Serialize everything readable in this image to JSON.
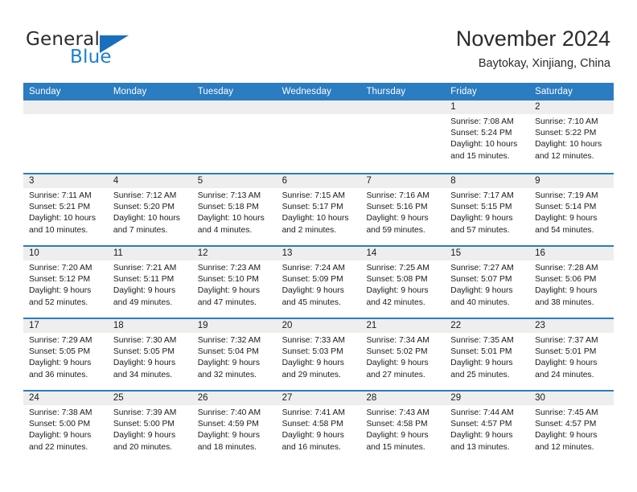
{
  "brand": {
    "name_part1": "General",
    "name_part2": "Blue",
    "logo_icon": "blue-triangle-icon"
  },
  "header": {
    "month_title": "November 2024",
    "location": "Baytokay, Xinjiang, China"
  },
  "colors": {
    "header_blue": "#2b7cc0",
    "day_band_gray": "#eeeeee",
    "brand_blue": "#1a7fd4",
    "text": "#1a1a1a"
  },
  "weekdays": [
    "Sunday",
    "Monday",
    "Tuesday",
    "Wednesday",
    "Thursday",
    "Friday",
    "Saturday"
  ],
  "labels": {
    "sunrise_prefix": "Sunrise: ",
    "sunset_prefix": "Sunset: ",
    "daylight_prefix": "Daylight: "
  },
  "weeks": [
    [
      {
        "day": "",
        "empty": true
      },
      {
        "day": "",
        "empty": true
      },
      {
        "day": "",
        "empty": true
      },
      {
        "day": "",
        "empty": true
      },
      {
        "day": "",
        "empty": true
      },
      {
        "day": "1",
        "sunrise": "Sunrise: 7:08 AM",
        "sunset": "Sunset: 5:24 PM",
        "daylight": "Daylight: 10 hours and 15 minutes."
      },
      {
        "day": "2",
        "sunrise": "Sunrise: 7:10 AM",
        "sunset": "Sunset: 5:22 PM",
        "daylight": "Daylight: 10 hours and 12 minutes."
      }
    ],
    [
      {
        "day": "3",
        "sunrise": "Sunrise: 7:11 AM",
        "sunset": "Sunset: 5:21 PM",
        "daylight": "Daylight: 10 hours and 10 minutes."
      },
      {
        "day": "4",
        "sunrise": "Sunrise: 7:12 AM",
        "sunset": "Sunset: 5:20 PM",
        "daylight": "Daylight: 10 hours and 7 minutes."
      },
      {
        "day": "5",
        "sunrise": "Sunrise: 7:13 AM",
        "sunset": "Sunset: 5:18 PM",
        "daylight": "Daylight: 10 hours and 4 minutes."
      },
      {
        "day": "6",
        "sunrise": "Sunrise: 7:15 AM",
        "sunset": "Sunset: 5:17 PM",
        "daylight": "Daylight: 10 hours and 2 minutes."
      },
      {
        "day": "7",
        "sunrise": "Sunrise: 7:16 AM",
        "sunset": "Sunset: 5:16 PM",
        "daylight": "Daylight: 9 hours and 59 minutes."
      },
      {
        "day": "8",
        "sunrise": "Sunrise: 7:17 AM",
        "sunset": "Sunset: 5:15 PM",
        "daylight": "Daylight: 9 hours and 57 minutes."
      },
      {
        "day": "9",
        "sunrise": "Sunrise: 7:19 AM",
        "sunset": "Sunset: 5:14 PM",
        "daylight": "Daylight: 9 hours and 54 minutes."
      }
    ],
    [
      {
        "day": "10",
        "sunrise": "Sunrise: 7:20 AM",
        "sunset": "Sunset: 5:12 PM",
        "daylight": "Daylight: 9 hours and 52 minutes."
      },
      {
        "day": "11",
        "sunrise": "Sunrise: 7:21 AM",
        "sunset": "Sunset: 5:11 PM",
        "daylight": "Daylight: 9 hours and 49 minutes."
      },
      {
        "day": "12",
        "sunrise": "Sunrise: 7:23 AM",
        "sunset": "Sunset: 5:10 PM",
        "daylight": "Daylight: 9 hours and 47 minutes."
      },
      {
        "day": "13",
        "sunrise": "Sunrise: 7:24 AM",
        "sunset": "Sunset: 5:09 PM",
        "daylight": "Daylight: 9 hours and 45 minutes."
      },
      {
        "day": "14",
        "sunrise": "Sunrise: 7:25 AM",
        "sunset": "Sunset: 5:08 PM",
        "daylight": "Daylight: 9 hours and 42 minutes."
      },
      {
        "day": "15",
        "sunrise": "Sunrise: 7:27 AM",
        "sunset": "Sunset: 5:07 PM",
        "daylight": "Daylight: 9 hours and 40 minutes."
      },
      {
        "day": "16",
        "sunrise": "Sunrise: 7:28 AM",
        "sunset": "Sunset: 5:06 PM",
        "daylight": "Daylight: 9 hours and 38 minutes."
      }
    ],
    [
      {
        "day": "17",
        "sunrise": "Sunrise: 7:29 AM",
        "sunset": "Sunset: 5:05 PM",
        "daylight": "Daylight: 9 hours and 36 minutes."
      },
      {
        "day": "18",
        "sunrise": "Sunrise: 7:30 AM",
        "sunset": "Sunset: 5:05 PM",
        "daylight": "Daylight: 9 hours and 34 minutes."
      },
      {
        "day": "19",
        "sunrise": "Sunrise: 7:32 AM",
        "sunset": "Sunset: 5:04 PM",
        "daylight": "Daylight: 9 hours and 32 minutes."
      },
      {
        "day": "20",
        "sunrise": "Sunrise: 7:33 AM",
        "sunset": "Sunset: 5:03 PM",
        "daylight": "Daylight: 9 hours and 29 minutes."
      },
      {
        "day": "21",
        "sunrise": "Sunrise: 7:34 AM",
        "sunset": "Sunset: 5:02 PM",
        "daylight": "Daylight: 9 hours and 27 minutes."
      },
      {
        "day": "22",
        "sunrise": "Sunrise: 7:35 AM",
        "sunset": "Sunset: 5:01 PM",
        "daylight": "Daylight: 9 hours and 25 minutes."
      },
      {
        "day": "23",
        "sunrise": "Sunrise: 7:37 AM",
        "sunset": "Sunset: 5:01 PM",
        "daylight": "Daylight: 9 hours and 24 minutes."
      }
    ],
    [
      {
        "day": "24",
        "sunrise": "Sunrise: 7:38 AM",
        "sunset": "Sunset: 5:00 PM",
        "daylight": "Daylight: 9 hours and 22 minutes."
      },
      {
        "day": "25",
        "sunrise": "Sunrise: 7:39 AM",
        "sunset": "Sunset: 5:00 PM",
        "daylight": "Daylight: 9 hours and 20 minutes."
      },
      {
        "day": "26",
        "sunrise": "Sunrise: 7:40 AM",
        "sunset": "Sunset: 4:59 PM",
        "daylight": "Daylight: 9 hours and 18 minutes."
      },
      {
        "day": "27",
        "sunrise": "Sunrise: 7:41 AM",
        "sunset": "Sunset: 4:58 PM",
        "daylight": "Daylight: 9 hours and 16 minutes."
      },
      {
        "day": "28",
        "sunrise": "Sunrise: 7:43 AM",
        "sunset": "Sunset: 4:58 PM",
        "daylight": "Daylight: 9 hours and 15 minutes."
      },
      {
        "day": "29",
        "sunrise": "Sunrise: 7:44 AM",
        "sunset": "Sunset: 4:57 PM",
        "daylight": "Daylight: 9 hours and 13 minutes."
      },
      {
        "day": "30",
        "sunrise": "Sunrise: 7:45 AM",
        "sunset": "Sunset: 4:57 PM",
        "daylight": "Daylight: 9 hours and 12 minutes."
      }
    ]
  ]
}
